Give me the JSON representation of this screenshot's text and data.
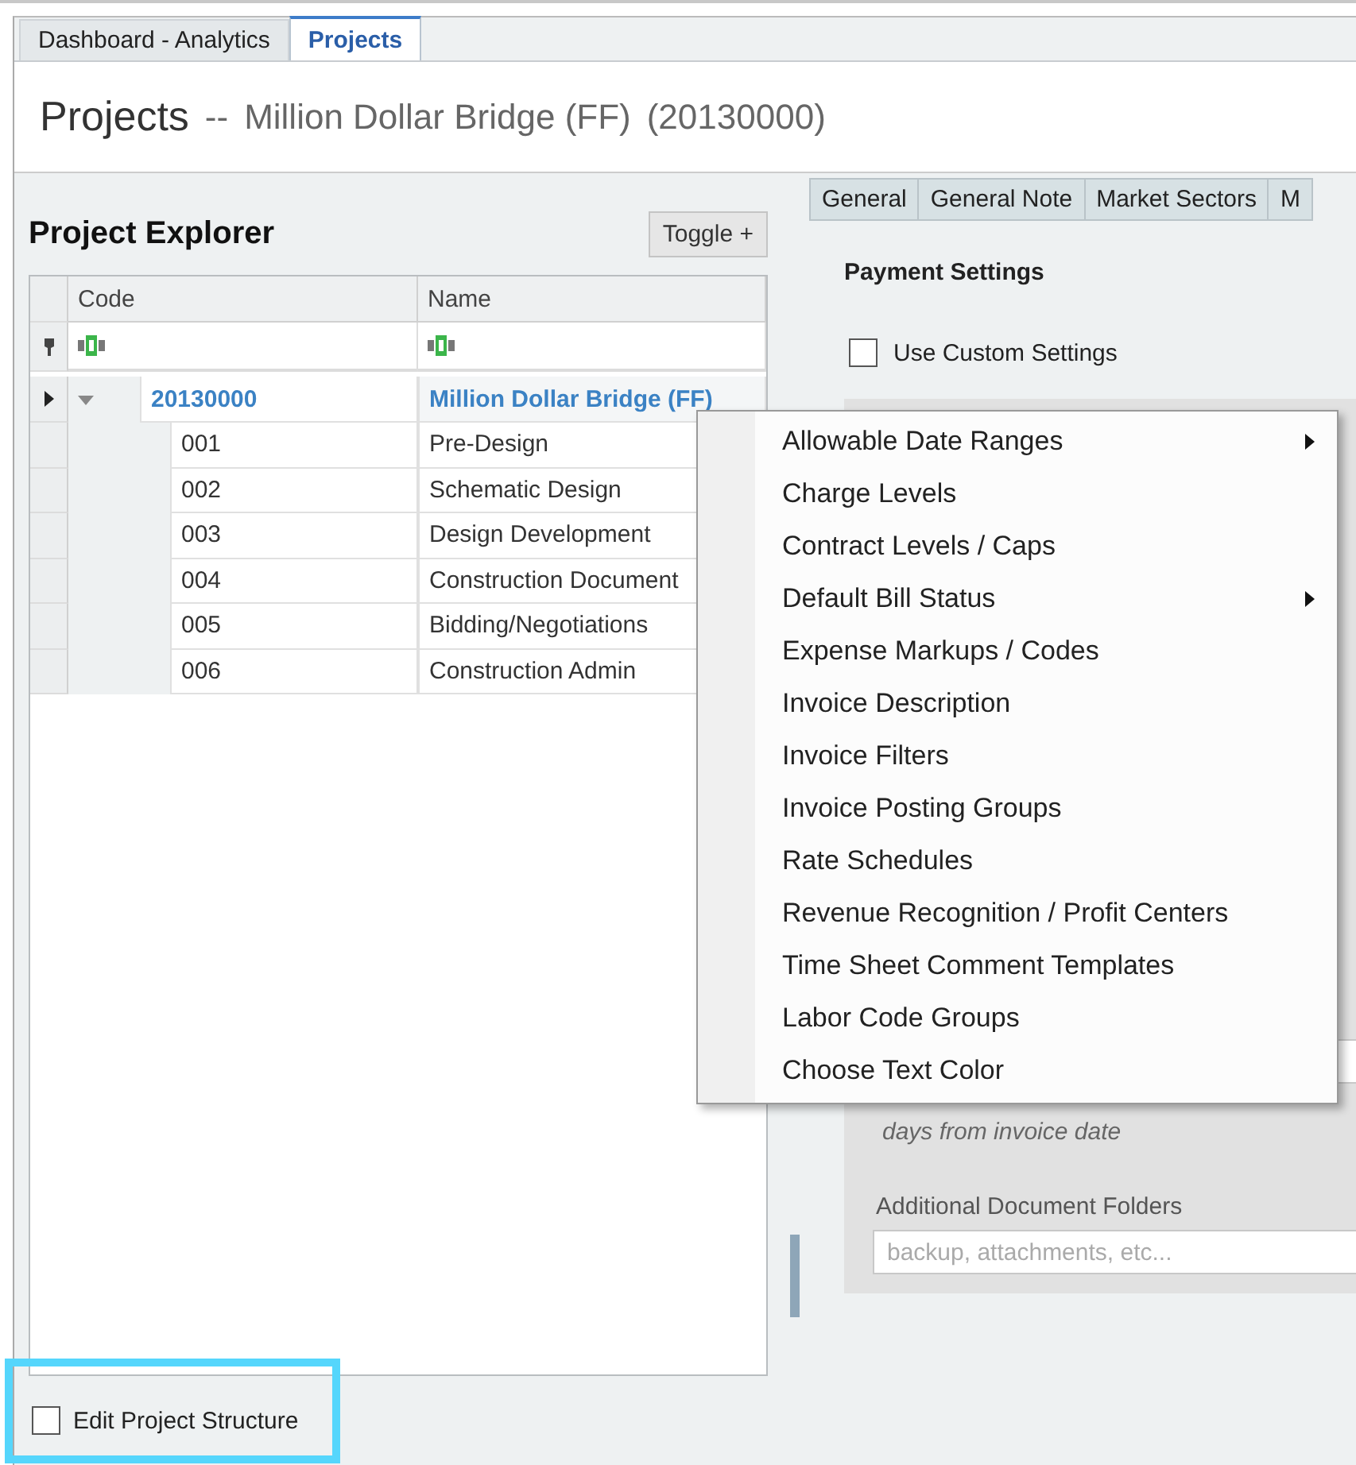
{
  "tabs": [
    {
      "label": "Dashboard - Analytics",
      "selected": false
    },
    {
      "label": "Projects",
      "selected": true
    }
  ],
  "header": {
    "title": "Projects",
    "separator": "--",
    "project": "Million Dollar Bridge (FF)",
    "number": "(20130000)"
  },
  "explorer": {
    "title": "Project Explorer",
    "toggle_button": "Toggle +",
    "columns": [
      "Code",
      "Name"
    ],
    "rows": [
      {
        "code": "20130000",
        "name": "Million Dollar Bridge (FF)",
        "expanded": true,
        "children": [
          {
            "code": "001",
            "name": "Pre-Design"
          },
          {
            "code": "002",
            "name": "Schematic Design"
          },
          {
            "code": "003",
            "name": "Design Development"
          },
          {
            "code": "004",
            "name": "Construction Document"
          },
          {
            "code": "005",
            "name": "Bidding/Negotiations"
          },
          {
            "code": "006",
            "name": "Construction Admin"
          }
        ]
      }
    ],
    "edit_structure": {
      "label": "Edit Project Structure",
      "checked": false
    }
  },
  "detail": {
    "tabs": [
      {
        "label": "General",
        "selected": false
      },
      {
        "label": "General Note",
        "selected": false
      },
      {
        "label": "Market Sectors",
        "selected": false
      },
      {
        "label": "M",
        "selected": false
      }
    ],
    "section_title": "Payment Settings",
    "custom_settings": {
      "label": "Use Custom Settings",
      "checked": false
    },
    "days_note": "days from invoice date",
    "folders_label": "Additional Document Folders",
    "folders_placeholder": "backup, attachments, etc..."
  },
  "context_menu": [
    {
      "label": "Allowable Date Ranges",
      "submenu": true
    },
    {
      "label": "Charge Levels",
      "submenu": false
    },
    {
      "label": "Contract Levels / Caps",
      "submenu": false
    },
    {
      "label": "Default Bill Status",
      "submenu": true
    },
    {
      "label": "Expense Markups / Codes",
      "submenu": false
    },
    {
      "label": "Invoice Description",
      "submenu": false
    },
    {
      "label": "Invoice Filters",
      "submenu": false
    },
    {
      "label": "Invoice Posting Groups",
      "submenu": false
    },
    {
      "label": "Rate Schedules",
      "submenu": false
    },
    {
      "label": "Revenue Recognition / Profit Centers",
      "submenu": false
    },
    {
      "label": "Time Sheet Comment Templates",
      "submenu": false
    },
    {
      "label": "Labor Code Groups",
      "submenu": false
    },
    {
      "label": "Choose Text Color",
      "submenu": false
    }
  ]
}
